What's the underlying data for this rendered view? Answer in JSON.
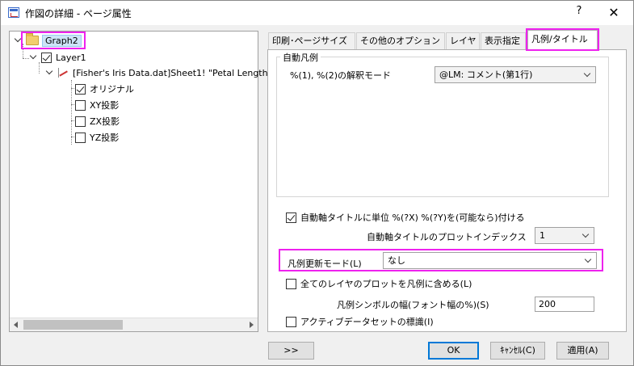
{
  "window": {
    "title": "作図の詳細 - ページ属性",
    "help_label": "?",
    "close_label": "✕"
  },
  "tree": {
    "root": "Graph2",
    "layer": "Layer1",
    "plot": "[Fisher's Iris Data.dat]Sheet1! \"Petal Length",
    "items": [
      {
        "label": "オリジナル",
        "checked": true
      },
      {
        "label": "XY投影",
        "checked": false
      },
      {
        "label": "ZX投影",
        "checked": false
      },
      {
        "label": "YZ投影",
        "checked": false
      }
    ]
  },
  "tabs": [
    {
      "label": "印刷･ページサイズ",
      "active": false
    },
    {
      "label": "その他のオプション",
      "active": false
    },
    {
      "label": "レイヤ",
      "active": false
    },
    {
      "label": "表示指定",
      "active": false
    },
    {
      "label": "凡例/タイトル",
      "active": true
    }
  ],
  "auto_legend": {
    "group_title": "自動凡例",
    "mode_label": "%(1), %(2)の解釈モード",
    "mode_value": "@LM: コメント(第1行)"
  },
  "options": {
    "auto_axis_title_units_label": "自動軸タイトルに単位 %(?X) %(?Y)を(可能なら)付ける",
    "auto_axis_title_units_checked": true,
    "plot_index_label": "自動軸タイトルのプロットインデックス",
    "plot_index_value": "1",
    "legend_update_label": "凡例更新モード(L)",
    "legend_update_value": "なし",
    "include_all_layers_label": "全てのレイヤのプロットを凡例に含める(L)",
    "include_all_layers_checked": false,
    "symbol_width_label": "凡例シンボルの幅(フォント幅の%)(S)",
    "symbol_width_value": "200",
    "active_dataset_label": "アクティブデータセットの標識(I)",
    "active_dataset_checked": false
  },
  "buttons": {
    "more": ">>",
    "ok": "OK",
    "cancel": "ｷｬﾝｾﾙ(C)",
    "apply": "適用(A)"
  },
  "colors": {
    "highlight": "#ee22ee"
  }
}
